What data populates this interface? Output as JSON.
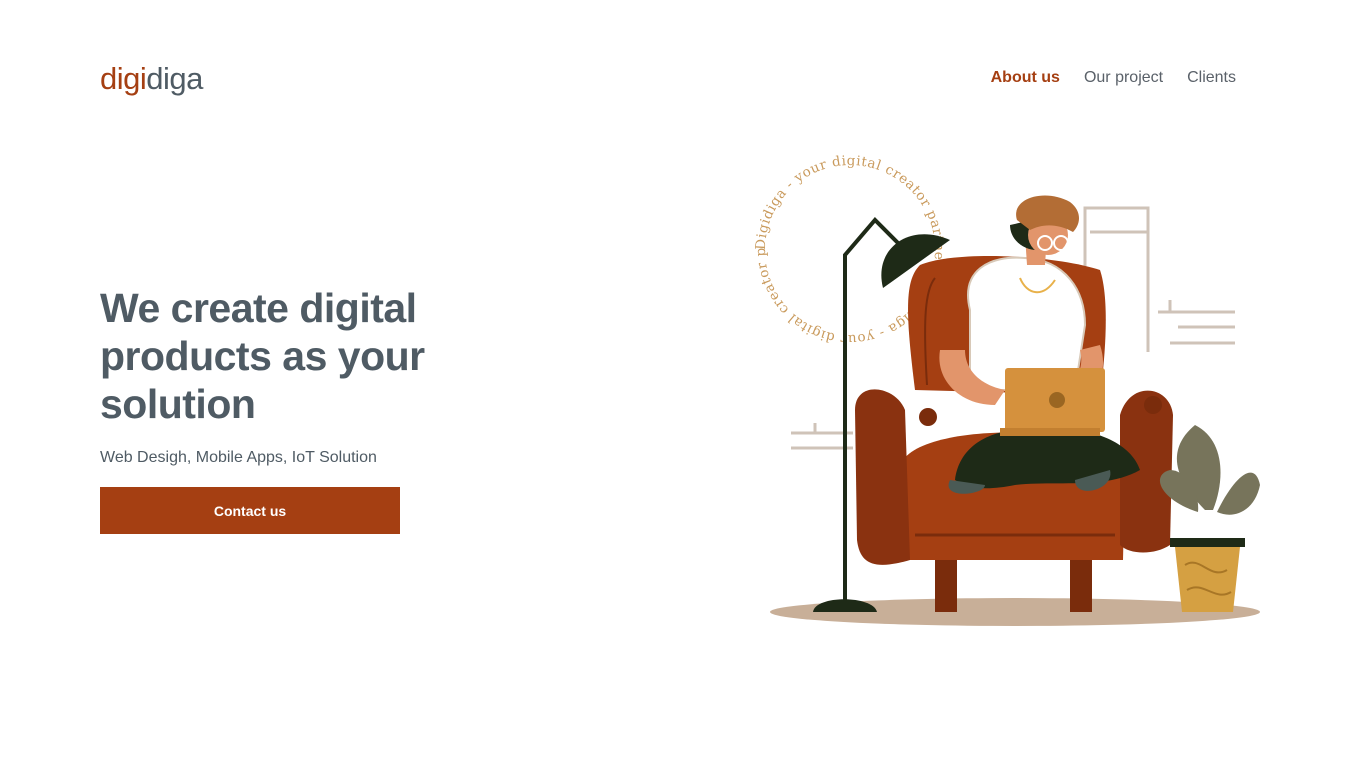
{
  "brand": {
    "part1": "digi",
    "part2": "diga"
  },
  "nav": {
    "items": [
      {
        "label": "About us"
      },
      {
        "label": "Our project"
      },
      {
        "label": "Clients"
      }
    ]
  },
  "hero": {
    "title": "We create digital products as your solution",
    "subtitle": "Web Desigh, Mobile Apps, IoT Solution",
    "cta_label": "Contact us",
    "badge_text": "Digidiga - your digital creator partner - Digidiga - your digital creator partner -"
  },
  "colors": {
    "accent": "#a53f12",
    "text": "#4f5b64",
    "nav_text": "#5a6169"
  }
}
